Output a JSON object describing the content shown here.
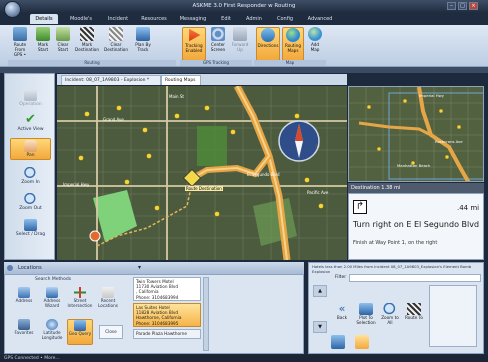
{
  "app": {
    "title": "ASKME 3.0 First Responder w Routing"
  },
  "tabs": [
    {
      "label": "Details"
    },
    {
      "label": "Moodle's"
    },
    {
      "label": "Incident"
    },
    {
      "label": "Resources"
    },
    {
      "label": "Messaging"
    },
    {
      "label": "Edit"
    },
    {
      "label": "Admin"
    },
    {
      "label": "Config"
    },
    {
      "label": "Advanced"
    }
  ],
  "ribbon": {
    "buttons": [
      {
        "label": "Route From GPS •"
      },
      {
        "label": "Mark Start"
      },
      {
        "label": "Clear Start"
      },
      {
        "label": "Mark Destination"
      },
      {
        "label": "Clear Destination"
      },
      {
        "label": "Plan By Track"
      },
      {
        "label": "Tracking Enabled"
      },
      {
        "label": "Center Screen"
      },
      {
        "label": "Forward Up"
      },
      {
        "label": "Directions"
      },
      {
        "label": "Routing Maps"
      },
      {
        "label": "Add Map"
      }
    ],
    "groups": [
      {
        "label": "Routing"
      },
      {
        "label": "GPS Tracking"
      },
      {
        "label": "Map"
      }
    ]
  },
  "sidebar": {
    "buttons": [
      {
        "label": "Operation"
      },
      {
        "label": "Active View"
      },
      {
        "label": "Pan"
      },
      {
        "label": "Zoom In"
      },
      {
        "label": "Zoom Out"
      },
      {
        "label": "Select / Drag"
      }
    ]
  },
  "map": {
    "tabs": [
      {
        "label": "Incident: 08_07_1A9803 - Explosion *"
      },
      {
        "label": "Routing Maps"
      }
    ],
    "labels": [
      {
        "text": "Imperial Hwy"
      },
      {
        "text": "Main St"
      },
      {
        "text": "Grand Ave"
      },
      {
        "text": "Pacific Ave"
      },
      {
        "text": "El Segundo Blvd"
      },
      {
        "text": "Route Destination"
      }
    ]
  },
  "minimap": {
    "labels": [
      {
        "text": "Imperial Hwy"
      },
      {
        "text": "Manhattan Beach"
      },
      {
        "text": "Rosecrans Ave"
      }
    ]
  },
  "directions": {
    "header": "Destination 1.38 mi",
    "distance": ".44 mi",
    "instruction": "Turn right on E El Segundo Blvd",
    "detail": "Finish at Way Point 1, on the right"
  },
  "locations": {
    "title": "Locations",
    "search_title": "Search Methods",
    "buttons": [
      {
        "label": "Address"
      },
      {
        "label": "Address Wizard"
      },
      {
        "label": "Street Intersection"
      },
      {
        "label": "Recent Locations"
      },
      {
        "label": "Favorites"
      },
      {
        "label": "Latitude Longitude"
      },
      {
        "label": "Geo Query"
      },
      {
        "label": "Close"
      }
    ],
    "results": [
      {
        "name": "Twin Towers Motel",
        "address": "11730 Aviation Blvd",
        "city": ", California",
        "phone": "Phone: 3104683994"
      },
      {
        "name": "Las Suites Hotel",
        "address": "11828 Aviation Blvd",
        "city": "Hawthorne, California",
        "phone": "Phone: 3104683995"
      },
      {
        "name": "Parade Plaza Hawthorne",
        "address": "",
        "city": "",
        "phone": ""
      }
    ]
  },
  "nearby": {
    "header": "Hotels less than 2.00 Miles from Incident 08_07_1A9803_Explosion's Element Bomb Explosion",
    "filter_label": "Filter",
    "buttons": [
      {
        "label": "Back"
      },
      {
        "label": "Plot To Selection"
      },
      {
        "label": "Zoom to All"
      },
      {
        "label": "Route To"
      }
    ]
  },
  "status": {
    "text": "GPS Connected  •  More..."
  },
  "colors": {
    "route": "#f0a03a",
    "accent": "#f3a83c",
    "map_bg": "#4d5e3f",
    "ribbon": "#dfe8f4"
  }
}
